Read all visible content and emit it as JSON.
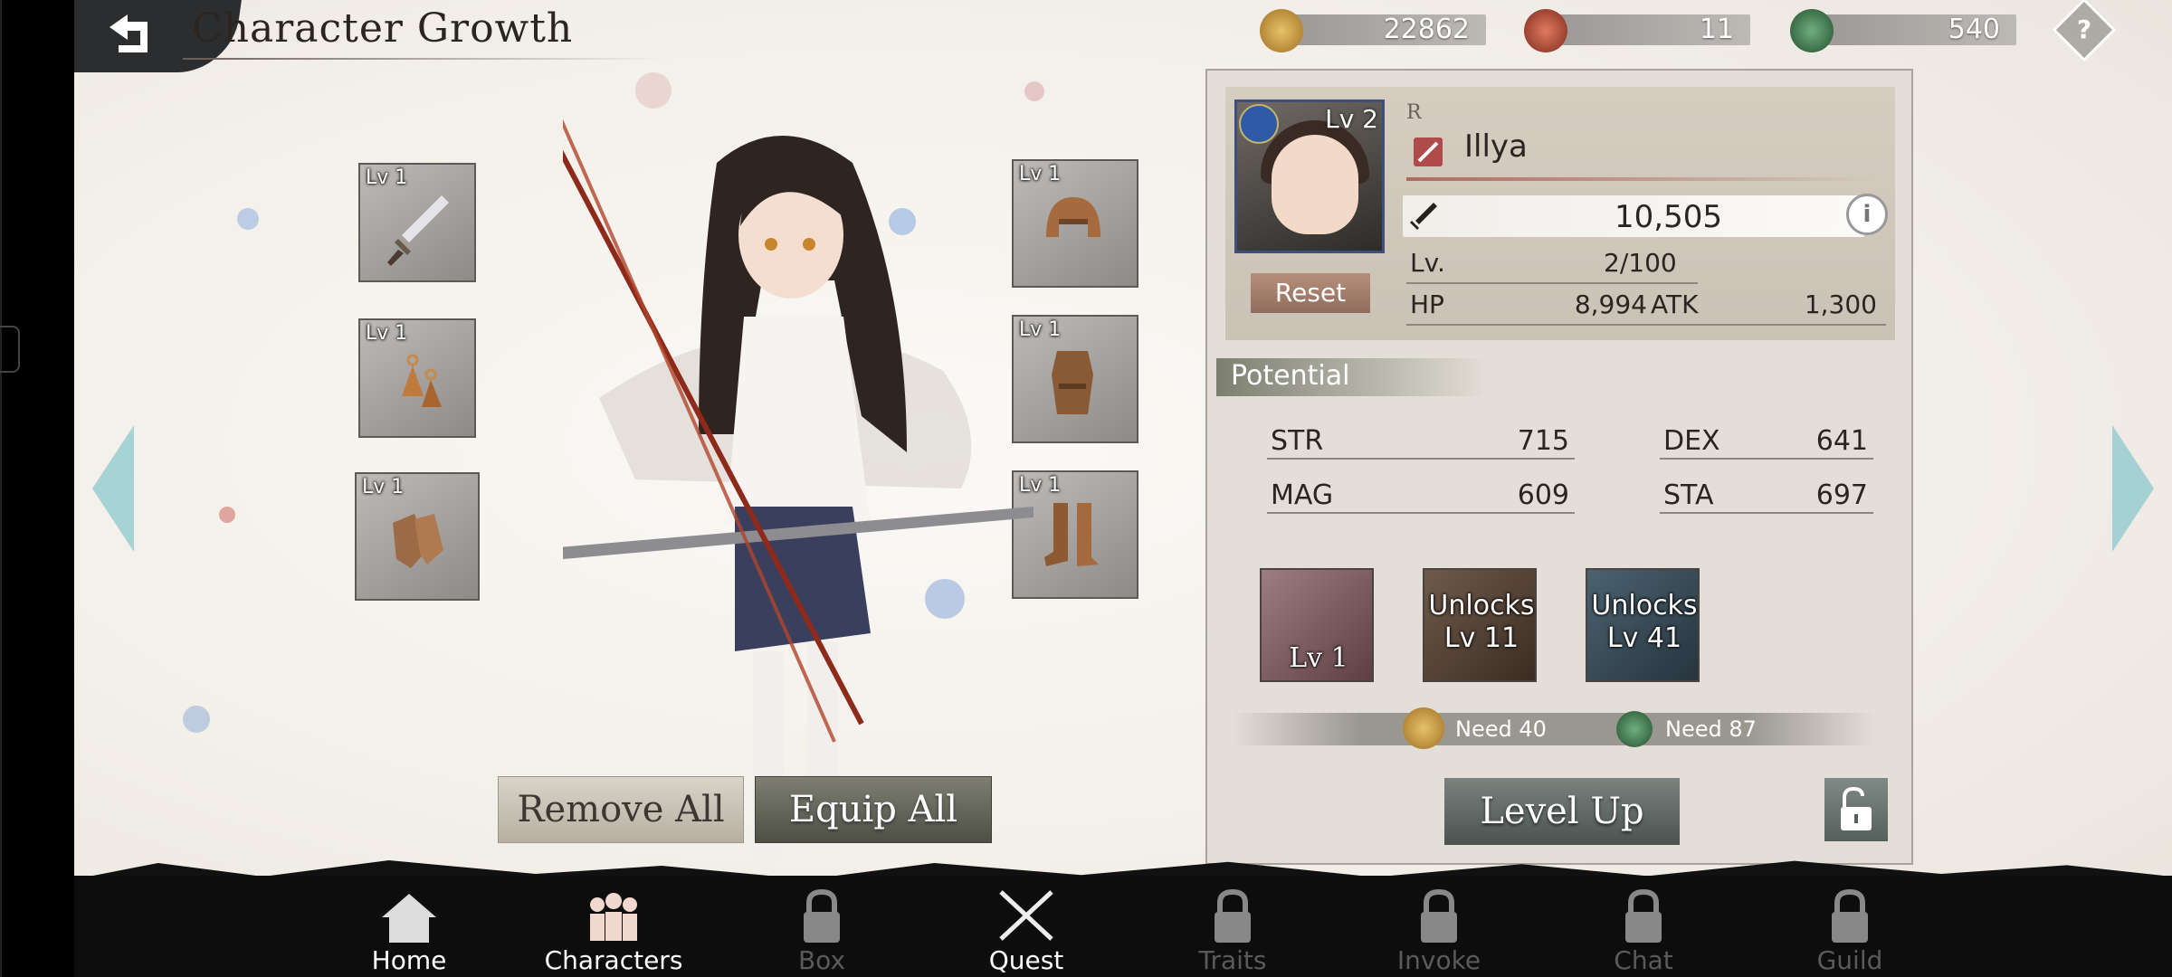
{
  "header": {
    "title": "Character Growth"
  },
  "currencies": [
    {
      "icon": "gold-coin-icon",
      "value": "22862",
      "color": "#c9983c"
    },
    {
      "icon": "red-orb-icon",
      "value": "11",
      "color": "#b8503c"
    },
    {
      "icon": "green-orb-icon",
      "value": "540",
      "color": "#3f7a52"
    }
  ],
  "equipment": {
    "left": [
      {
        "name": "weapon",
        "level": "Lv 1",
        "icon": "dagger-icon"
      },
      {
        "name": "accessory",
        "level": "Lv 1",
        "icon": "earring-icon"
      },
      {
        "name": "gloves",
        "level": "Lv 1",
        "icon": "gloves-icon"
      }
    ],
    "right": [
      {
        "name": "helmet",
        "level": "Lv 1",
        "icon": "helmet-icon"
      },
      {
        "name": "armor",
        "level": "Lv 1",
        "icon": "armor-icon"
      },
      {
        "name": "boots",
        "level": "Lv 1",
        "icon": "boots-icon"
      }
    ]
  },
  "actions": {
    "remove_all": "Remove All",
    "equip_all": "Equip All"
  },
  "character": {
    "portrait_level": "Lv 2",
    "rarity": "R",
    "name": "Illya",
    "power": "10,505",
    "level_label": "Lv.",
    "level_value": "2/100",
    "hp_label": "HP",
    "hp_value": "8,994",
    "atk_label": "ATK",
    "atk_value": "1,300",
    "reset_label": "Reset"
  },
  "potential": {
    "title": "Potential",
    "stats": [
      {
        "label": "STR",
        "value": "715"
      },
      {
        "label": "DEX",
        "value": "641"
      },
      {
        "label": "MAG",
        "value": "609"
      },
      {
        "label": "STA",
        "value": "697"
      }
    ],
    "skills": [
      {
        "text": "Lv 1"
      },
      {
        "text": "Unlocks Lv 11"
      },
      {
        "text": "Unlocks Lv 41"
      }
    ],
    "needs": [
      {
        "icon": "gold-coin-icon",
        "text": "Need 40"
      },
      {
        "icon": "green-orb-icon",
        "text": "Need 87"
      }
    ],
    "level_up": "Level Up"
  },
  "nav": [
    {
      "label": "Home",
      "locked": false
    },
    {
      "label": "Characters",
      "locked": false
    },
    {
      "label": "Box",
      "locked": true
    },
    {
      "label": "Quest",
      "locked": false
    },
    {
      "label": "Traits",
      "locked": true
    },
    {
      "label": "Invoke",
      "locked": true
    },
    {
      "label": "Chat",
      "locked": true
    },
    {
      "label": "Guild",
      "locked": true
    }
  ]
}
